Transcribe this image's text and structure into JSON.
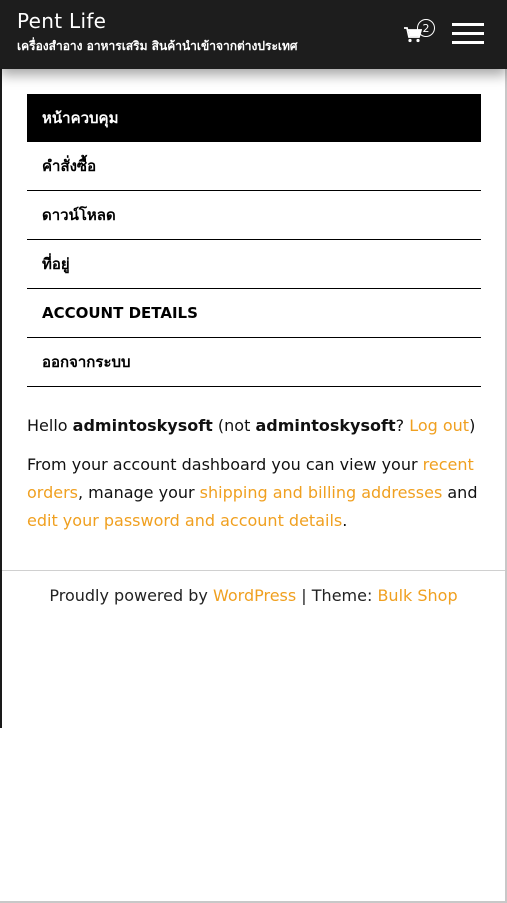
{
  "header": {
    "site_title": "Pent Life",
    "site_description": "เครื่องสำอาง อาหารเสริม สินค้านำเข้าจากต่างประเทศ",
    "cart_count": "2"
  },
  "account_nav": [
    {
      "label": "หน้าควบคุม",
      "active": true
    },
    {
      "label": "คำสั่งซื้อ"
    },
    {
      "label": "ดาวน์โหลด"
    },
    {
      "label": "ที่อยู่"
    },
    {
      "label": "ACCOUNT DETAILS"
    },
    {
      "label": "ออกจากระบบ"
    }
  ],
  "content": {
    "hello": "Hello",
    "username": "admintoskysoft",
    "not_text": "(not",
    "username2": "admintoskysoft",
    "question": "?",
    "logout_link": "Log out",
    "close_paren": ")",
    "dash_text_1": "From your account dashboard you can view your",
    "recent_orders_link": "recent orders",
    "dash_text_2": ", manage your",
    "addresses_link": "shipping and billing addresses",
    "dash_text_3": "and",
    "account_details_link": "edit your password and account details",
    "dash_text_4": "."
  },
  "footer": {
    "powered_text": "Proudly powered by",
    "wordpress_link": "WordPress",
    "separator": "|",
    "theme_text": "Theme:",
    "theme_link": "Bulk Shop"
  },
  "colors": {
    "header_bg": "#1d1d1d",
    "link": "#f0a020",
    "active_nav_bg": "#000000"
  }
}
